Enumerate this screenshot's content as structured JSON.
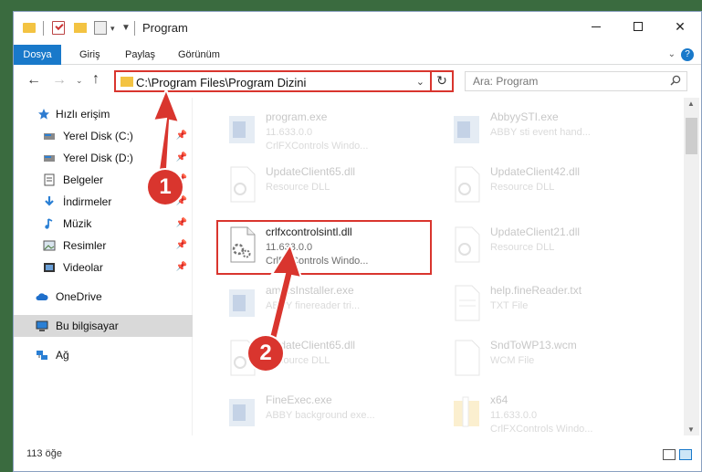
{
  "window": {
    "title": "Program",
    "quick_access_dropdown": "▾"
  },
  "ribbon": {
    "tabs": [
      "Dosya",
      "Giriş",
      "Paylaş",
      "Görünüm"
    ],
    "help": "?"
  },
  "nav": {
    "address": "C:\\Program Files\\Program Dizini",
    "search_placeholder": "Ara: Program"
  },
  "sidebar": {
    "items": [
      {
        "label": "Hızlı erişim",
        "icon": "star-icon",
        "pinned": false
      },
      {
        "label": "Yerel Disk (C:)",
        "icon": "drive-icon",
        "pinned": true
      },
      {
        "label": "Yerel Disk (D:)",
        "icon": "drive-icon",
        "pinned": true
      },
      {
        "label": "Belgeler",
        "icon": "documents-icon",
        "pinned": true
      },
      {
        "label": "İndirmeler",
        "icon": "download-icon",
        "pinned": true
      },
      {
        "label": "Müzik",
        "icon": "music-icon",
        "pinned": true
      },
      {
        "label": "Resimler",
        "icon": "pictures-icon",
        "pinned": true
      },
      {
        "label": "Videolar",
        "icon": "videos-icon",
        "pinned": true
      },
      {
        "label": "OneDrive",
        "icon": "cloud-icon",
        "pinned": false
      },
      {
        "label": "Bu bilgisayar",
        "icon": "computer-icon",
        "pinned": false
      },
      {
        "label": "Ağ",
        "icon": "network-icon",
        "pinned": false
      }
    ]
  },
  "files": {
    "left": [
      {
        "name": "program.exe",
        "sub1": "11.633.0.0",
        "sub2": "CrlFXControls Windo...",
        "icon": "exe-icon"
      },
      {
        "name": "UpdateClient65.dll",
        "sub1": "Resource DLL",
        "sub2": "",
        "icon": "dll-icon"
      },
      {
        "name": "crlfxcontrolsintl.dll",
        "sub1": "11.633.0.0",
        "sub2": "CrlFXControls Windo...",
        "icon": "dll-gear-icon"
      },
      {
        "name": "ammsInstaller.exe",
        "sub1": "ABBY finereader tri...",
        "sub2": "",
        "icon": "exe-icon"
      },
      {
        "name": "UpdateClient65.dll",
        "sub1": "Resource DLL",
        "sub2": "",
        "icon": "dll-icon"
      },
      {
        "name": "FineExec.exe",
        "sub1": "ABBY background exe...",
        "sub2": "",
        "icon": "exe-icon"
      }
    ],
    "right": [
      {
        "name": "AbbyySTI.exe",
        "sub1": "ABBY sti event hand...",
        "sub2": "",
        "icon": "exe-icon"
      },
      {
        "name": "UpdateClient42.dll",
        "sub1": "Resource DLL",
        "sub2": "",
        "icon": "dll-icon"
      },
      {
        "name": "UpdateClient21.dll",
        "sub1": "Resource DLL",
        "sub2": "",
        "icon": "dll-icon"
      },
      {
        "name": "help.fineReader.txt",
        "sub1": "TXT File",
        "sub2": "",
        "icon": "txt-icon"
      },
      {
        "name": "SndToWP13.wcm",
        "sub1": "WCM File",
        "sub2": "",
        "icon": "wcm-icon"
      },
      {
        "name": "x64",
        "sub1": "11.633.0.0",
        "sub2": "CrlFXControls Windo...",
        "icon": "folder-icon"
      }
    ]
  },
  "status": {
    "count": "113 öğe"
  },
  "markers": [
    "1",
    "2"
  ],
  "colors": {
    "accent": "#1979ca",
    "highlight": "#d9352e",
    "folder": "#f3c342"
  }
}
